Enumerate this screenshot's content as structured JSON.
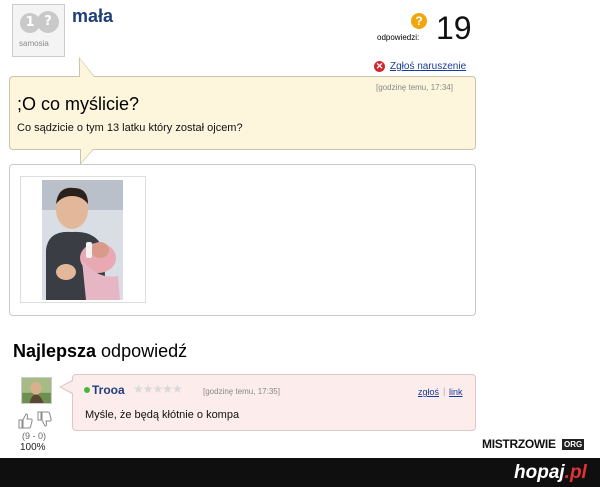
{
  "question": {
    "author": "mała",
    "avatar_brand": "samosia",
    "avatar_glyphs": [
      "1",
      "?"
    ],
    "answers_label": "odpowiedzi:",
    "answers_count": "19",
    "report_label": "Zgłoś naruszenie",
    "timestamp": "[godzinę temu, 17:34]",
    "title": ";O co myślicie?",
    "body": "Co sądzicie o tym 13 latku który został ojcem?"
  },
  "best_answer": {
    "heading_bold": "Najlepsza",
    "heading_rest": " odpowiedź",
    "user": "Trooa",
    "stars": "★★★★★",
    "rating_stars": 0,
    "timestamp": "[godzinę temu, 17:35]",
    "report_label": "zgłoś",
    "separator": "|",
    "link_label": "link",
    "text": "Myśle, że będą kłótnie o kompa",
    "votes": "(9 - 0)",
    "percent": "100%"
  },
  "watermarks": {
    "mistrzowie": "MISTRZOWIE",
    "mistrzowie_org": "ORG",
    "hopaj_main": "hopaj",
    "hopaj_suffix": ".pl"
  },
  "colors": {
    "username": "#1f3f7a",
    "link": "#1a3a9a",
    "question_bg": "#fdf6dc",
    "answer_bg": "#fdecec",
    "online": "#4bb53a",
    "report_icon": "#d2262f",
    "question_icon": "#f0a60c"
  },
  "icons": [
    "question-mark-icon",
    "report-icon",
    "thumb-up-icon",
    "thumb-down-icon",
    "star-icon",
    "online-dot-icon"
  ]
}
